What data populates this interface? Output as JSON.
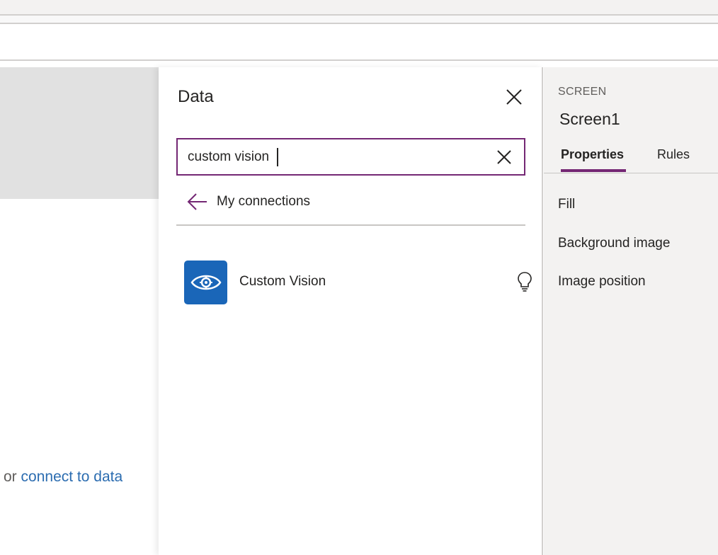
{
  "canvas": {
    "hint_or": "or",
    "hint_link": "connect to data"
  },
  "data_panel": {
    "title": "Data",
    "search": {
      "value": "custom vision",
      "placeholder": ""
    },
    "back_label": "My connections",
    "results": [
      {
        "label": "Custom Vision",
        "icon": "eye-gear-icon"
      }
    ]
  },
  "properties_panel": {
    "kind": "SCREEN",
    "name": "Screen1",
    "tabs": [
      "Properties",
      "Rules"
    ],
    "active_tab": "Properties",
    "items": [
      "Fill",
      "Background image",
      "Image position"
    ]
  },
  "colors": {
    "accent": "#742774",
    "connector_icon_bg": "#1a66b8",
    "link": "#2b6cb0"
  }
}
